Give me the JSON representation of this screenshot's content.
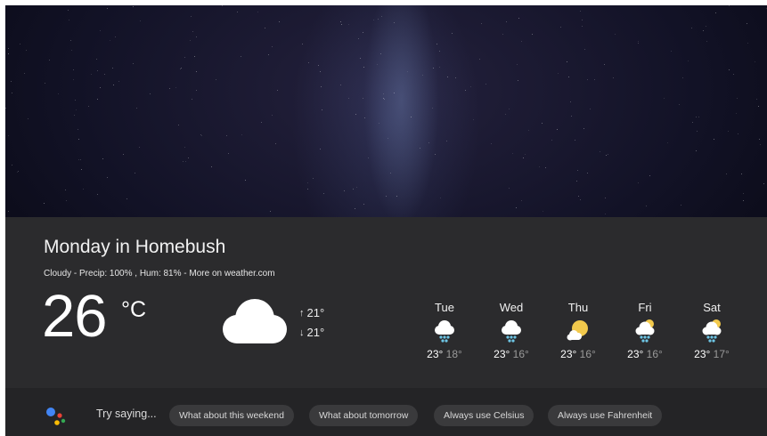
{
  "title": "Monday in Homebush",
  "subtitle": "Cloudy - Precip: 100%  ,  Hum: 81% - More on weather.com",
  "current": {
    "temperature": "26",
    "unit": "°C",
    "icon": "cloud-icon",
    "high": "21°",
    "low": "21°",
    "high_arrow": "↑",
    "low_arrow": "↓"
  },
  "forecast": [
    {
      "day": "Tue",
      "high": "23°",
      "low": "18°",
      "icon": "cloud-snow-icon"
    },
    {
      "day": "Wed",
      "high": "23°",
      "low": "16°",
      "icon": "cloud-snow-icon"
    },
    {
      "day": "Thu",
      "high": "23°",
      "low": "16°",
      "icon": "partly-cloudy-sun-icon"
    },
    {
      "day": "Fri",
      "high": "23°",
      "low": "16°",
      "icon": "sun-cloud-snow-icon"
    },
    {
      "day": "Sat",
      "high": "23°",
      "low": "17°",
      "icon": "sun-cloud-snow-icon"
    }
  ],
  "footer": {
    "try_label": "Try saying...",
    "suggestions": [
      "What about this weekend",
      "What about tomorrow",
      "Always use Celsius",
      "Always use Fahrenheit"
    ]
  },
  "colors": {
    "panel_bg": "#2b2b2d",
    "footer_bg": "#242426",
    "chip_bg": "#3a3a3c",
    "snow_dots": "#6ec6e6",
    "sun": "#f2c94c",
    "assistant_blue": "#4285f4",
    "assistant_red": "#ea4335",
    "assistant_yellow": "#fbbc05",
    "assistant_green": "#34a853"
  }
}
